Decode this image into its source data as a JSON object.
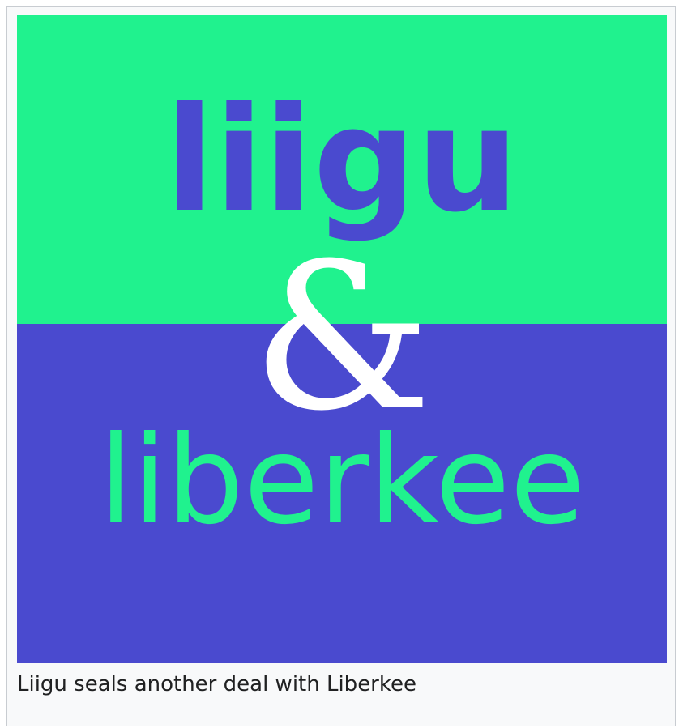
{
  "figure": {
    "logo": {
      "word_top": "liigu",
      "ampersand": "&",
      "word_bottom": "liberkee"
    },
    "caption": "Liigu seals another deal with Liberkee"
  },
  "colors": {
    "green": "#20f28e",
    "blue": "#4a4acf",
    "white": "#ffffff"
  }
}
